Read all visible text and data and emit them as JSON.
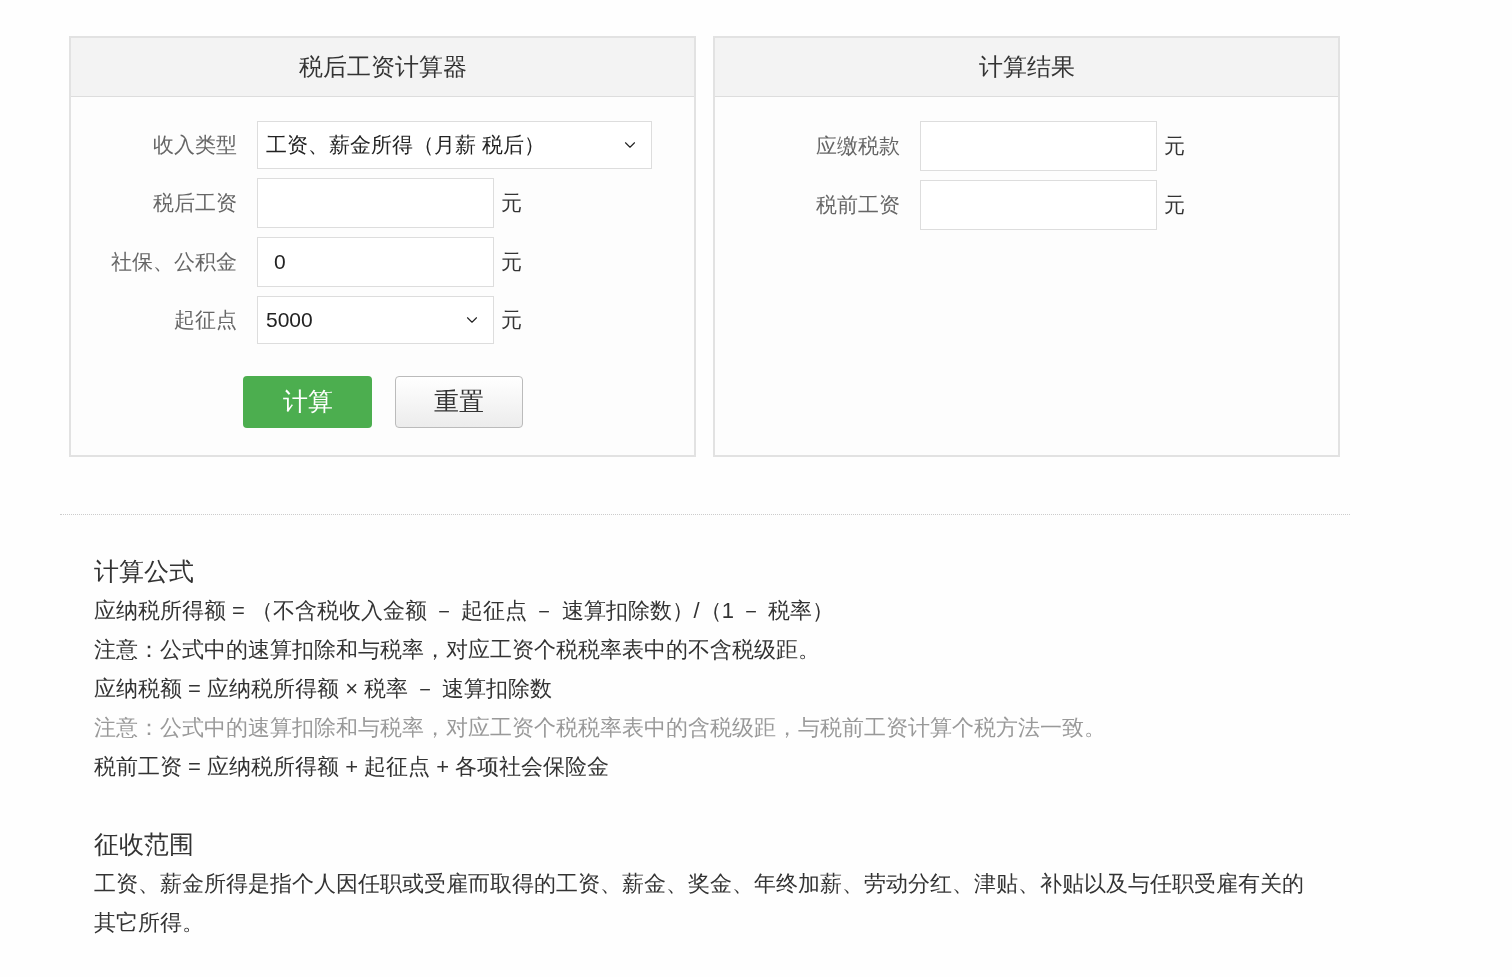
{
  "calculator": {
    "title": "税后工资计算器",
    "rows": [
      {
        "kind": "select",
        "label": "收入类型",
        "value": "工资、薪金所得（月薪 税后）",
        "wide": true
      },
      {
        "kind": "input",
        "label": "税后工资",
        "value": "",
        "unit": "元"
      },
      {
        "kind": "input",
        "label": "社保、公积金",
        "value": "0",
        "unit": "元"
      },
      {
        "kind": "select",
        "label": "起征点",
        "value": "5000",
        "unit": "元",
        "wide": false
      }
    ],
    "buttons": [
      {
        "kind": "primary",
        "label": "计算"
      },
      {
        "kind": "secondary",
        "label": "重置"
      }
    ]
  },
  "result": {
    "title": "计算结果",
    "rows": [
      {
        "label": "应缴税款",
        "value": "",
        "unit": "元"
      },
      {
        "label": "税前工资",
        "value": "",
        "unit": "元"
      }
    ]
  },
  "formula": {
    "heading": "计算公式",
    "lines": [
      {
        "text": "应纳税所得额 = （不含税收入金额 － 起征点 － 速算扣除数）/（1 － 税率）",
        "muted": false
      },
      {
        "text": "注意：公式中的速算扣除和与税率，对应工资个税税率表中的不含税级距。",
        "muted": false
      },
      {
        "text": "应纳税额 = 应纳税所得额 × 税率 － 速算扣除数",
        "muted": false
      },
      {
        "text": "注意：公式中的速算扣除和与税率，对应工资个税税率表中的含税级距，与税前工资计算个税方法一致。",
        "muted": true
      },
      {
        "text": "税前工资 = 应纳税所得额 + 起征点 + 各项社会保险金",
        "muted": false
      }
    ]
  },
  "scope": {
    "heading": "征收范围",
    "text": "工资、薪金所得是指个人因任职或受雇而取得的工资、薪金、奖金、年终加薪、劳动分红、津贴、补贴以及与任职受雇有关的其它所得。"
  }
}
